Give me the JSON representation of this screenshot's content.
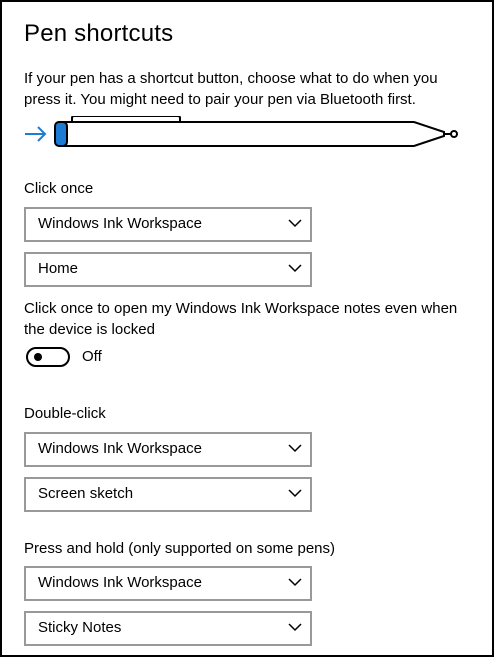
{
  "page": {
    "title": "Pen shortcuts",
    "description": "If your pen has a shortcut button, choose what to do when you press it. You might need to pair your pen via Bluetooth first."
  },
  "colors": {
    "accent": "#1e7bd3",
    "border": "#999999",
    "text": "#000000"
  },
  "icons": {
    "pen_pointer": "arrow-right-icon",
    "dropdown": "chevron-down-icon"
  },
  "click_once": {
    "label": "Click once",
    "app": "Windows Ink Workspace",
    "action": "Home",
    "locked_label": "Click once to open my Windows Ink Workspace notes even when the device is locked",
    "locked_toggle": {
      "state": "Off",
      "on": false
    }
  },
  "double_click": {
    "label": "Double-click",
    "app": "Windows Ink Workspace",
    "action": "Screen sketch"
  },
  "press_hold": {
    "label": "Press and hold (only supported on some pens)",
    "app": "Windows Ink Workspace",
    "action": "Sticky Notes"
  }
}
